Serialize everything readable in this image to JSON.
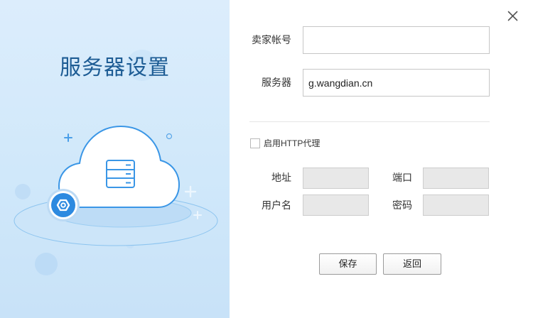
{
  "left_panel": {
    "title": "服务器设置",
    "illustration_icons": [
      "cloud-icon",
      "server-icon",
      "gear-icon",
      "plus-icon"
    ]
  },
  "window": {
    "close_icon": "close-icon"
  },
  "form": {
    "account": {
      "label": "卖家帐号",
      "value": "",
      "placeholder": ""
    },
    "server": {
      "label": "服务器",
      "value": "g.wangdian.cn",
      "placeholder": ""
    },
    "proxy": {
      "checked": false,
      "label": "启用HTTP代理",
      "address": {
        "label": "地址",
        "value": ""
      },
      "port": {
        "label": "端口",
        "value": ""
      },
      "username": {
        "label": "用户名",
        "value": ""
      },
      "password": {
        "label": "密码",
        "value": ""
      }
    }
  },
  "buttons": {
    "save_label": "保存",
    "back_label": "返回"
  },
  "colors": {
    "panel_background": "#d0e8fa",
    "title": "#1d5c94",
    "accent": "#2d8ae0",
    "disabled_field": "#e8e8e8"
  }
}
